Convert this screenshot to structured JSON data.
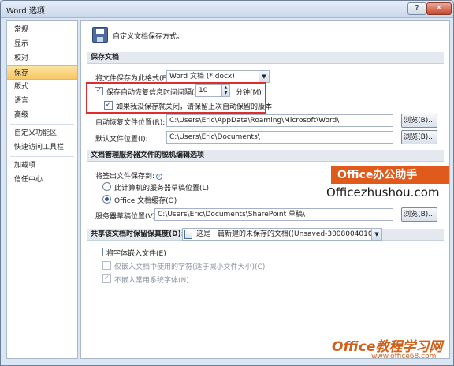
{
  "window": {
    "title": "Word 选项",
    "help_label": "?",
    "close_label": "✕"
  },
  "sidebar": {
    "items": [
      {
        "label": "常规"
      },
      {
        "label": "显示"
      },
      {
        "label": "校对"
      },
      {
        "label": "保存",
        "active": true
      },
      {
        "label": "版式"
      },
      {
        "label": "语言"
      },
      {
        "label": "高级"
      },
      {
        "label": "自定义功能区"
      },
      {
        "label": "快速访问工具栏"
      },
      {
        "label": "加载项"
      },
      {
        "label": "信任中心"
      }
    ]
  },
  "header": {
    "text": "自定义文档保存方式。",
    "icon": "save-icon"
  },
  "save_docs": {
    "section_title": "保存文档",
    "format_label": "将文件保存为此格式(F):",
    "format_value": "Word 文档 (*.docx)",
    "autorecover_label": "保存自动恢复信息时间间隔(A)",
    "autorecover_checked": true,
    "autorecover_minutes": "10",
    "minutes_unit": "分钟(M)",
    "keep_last_label": "如果我没保存就关闭，请保留上次自动保留的版本",
    "keep_last_checked": true,
    "autorecover_location_label": "自动恢复文件位置(R):",
    "autorecover_location_value": "C:\\Users\\Eric\\AppData\\Roaming\\Microsoft\\Word\\",
    "default_location_label": "默认文件位置(I):",
    "default_location_value": "C:\\Users\\Eric\\Documents\\",
    "browse_label": "浏览(B)..."
  },
  "offline": {
    "section_title": "文档管理服务器文件的脱机编辑选项",
    "save_to_label": "将签出文件保存到:",
    "option_server": "此计算机的服务器草稿位置(L)",
    "option_cache": "Office 文档缓存(O)",
    "selected": "cache",
    "drafts_label": "服务器草稿位置(V):",
    "drafts_value": "C:\\Users\\Eric\\Documents\\SharePoint 草稿\\",
    "browse_label": "浏览(B)..."
  },
  "fidelity": {
    "section_title": "共享该文档时保留保真度(D):",
    "doc_value": "这是一篇新建的未保存的文档((Unsaved-30080040107237...",
    "embed_fonts_label": "将字体嵌入文件(E)",
    "embed_fonts_checked": false,
    "embed_used_only_label": "仅嵌入文档中使用的字符(适于减小文件大小)(C)",
    "no_common_fonts_label": "不嵌入常用系统字体(N)",
    "no_common_fonts_checked": true
  },
  "watermark": {
    "brand": "Office办公助手",
    "url": "Officezhushou.com",
    "bottom_brand": "Office教程学习网",
    "bottom_url": "www.office68.com"
  }
}
